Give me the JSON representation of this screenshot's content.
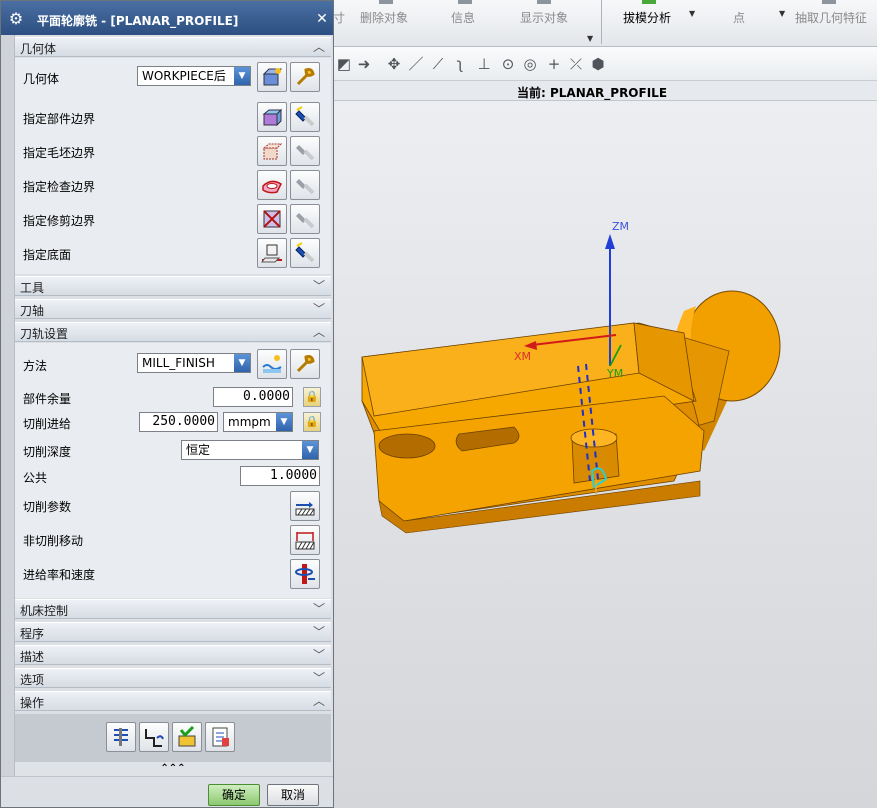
{
  "toolbar": {
    "items": [
      {
        "label": "删除对象"
      },
      {
        "label": "信息"
      },
      {
        "label": "显示对象"
      },
      {
        "label": "拔模分析"
      },
      {
        "label": "点"
      },
      {
        "label": "抽取几何特征"
      }
    ],
    "partial_label": "寸"
  },
  "viewport": {
    "current_label": "当前: PLANAR_PROFILE",
    "axes": {
      "z": "ZM",
      "x": "XM",
      "y": "YM"
    }
  },
  "dialog": {
    "title": "平面轮廓铣 - [PLANAR_PROFILE]",
    "sections": {
      "geometry": {
        "header": "几何体",
        "label": "几何体",
        "value": "WORKPIECE后",
        "rows": [
          "指定部件边界",
          "指定毛坯边界",
          "指定检查边界",
          "指定修剪边界",
          "指定底面"
        ]
      },
      "tool": {
        "header": "工具"
      },
      "tool_axis": {
        "header": "刀轴"
      },
      "path_settings": {
        "header": "刀轨设置",
        "method_label": "方法",
        "method_value": "MILL_FINISH",
        "part_stock_label": "部件余量",
        "part_stock_value": "0.0000",
        "feed_label": "切削进给",
        "feed_value": "250.0000",
        "feed_unit": "mmpm",
        "depth_label": "切削深度",
        "depth_value": "恒定",
        "common_label": "公共",
        "common_value": "1.0000",
        "cut_params_label": "切削参数",
        "non_cut_label": "非切削移动",
        "feeds_speeds_label": "进给率和速度"
      },
      "machine_control": {
        "header": "机床控制"
      },
      "program": {
        "header": "程序"
      },
      "description": {
        "header": "描述"
      },
      "options": {
        "header": "选项"
      },
      "operations": {
        "header": "操作"
      }
    },
    "ok_label": "确定",
    "cancel_label": "取消"
  },
  "colors": {
    "part": "#f5a300",
    "part_dark": "#c27a00",
    "title_bar": "#2d4f81",
    "ok_button": "#8bc86f"
  }
}
